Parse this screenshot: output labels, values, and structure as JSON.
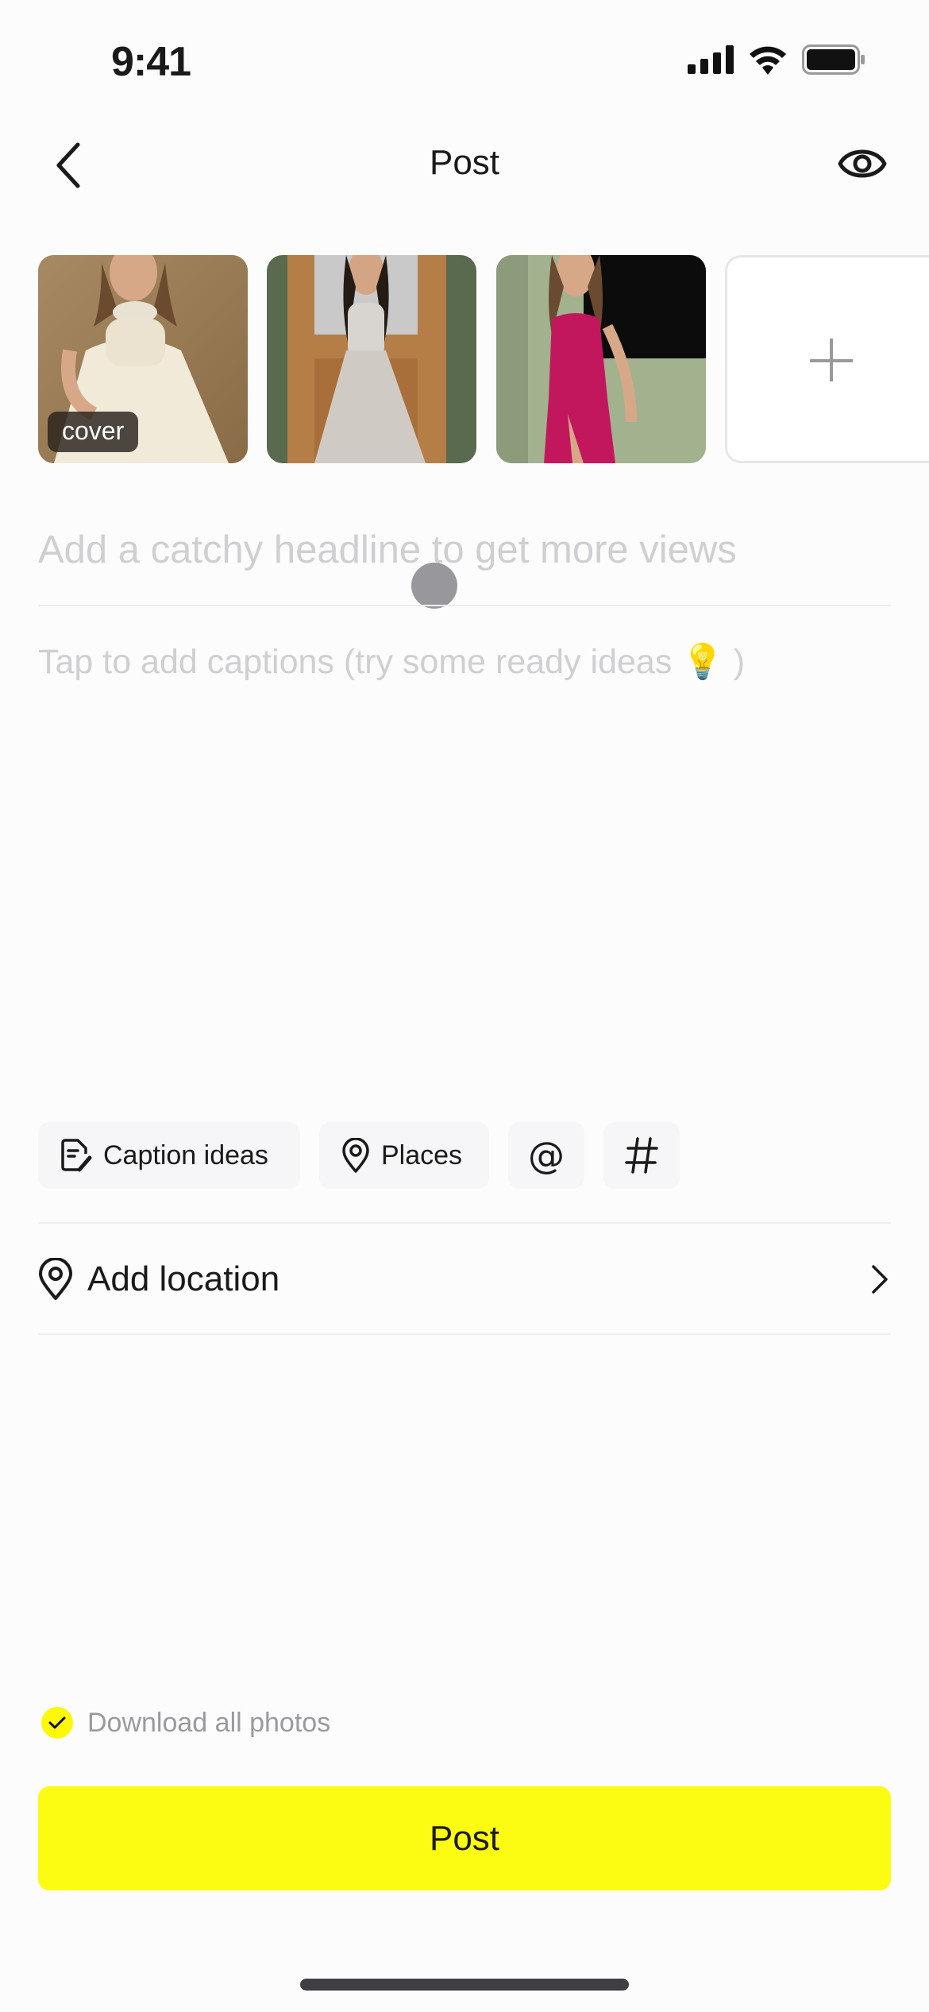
{
  "status_bar": {
    "time": "9:41"
  },
  "nav": {
    "title": "Post",
    "back_icon": "chevron-left-icon",
    "preview_icon": "eye-icon"
  },
  "photos": [
    {
      "description": "Woman in ivory satin gown with pearl necklace",
      "badge": "cover",
      "bg": "#b89a72",
      "dress": "#efe8d8"
    },
    {
      "description": "Woman in silver gown in front of wooden door",
      "badge": "",
      "bg": "#b7824c",
      "dress": "#cfccc6"
    },
    {
      "description": "Woman in magenta satin dress by green wall",
      "badge": "",
      "bg": "#8e9f7e",
      "dress": "#c1185d"
    }
  ],
  "add_photo": {
    "icon": "plus-icon"
  },
  "editor": {
    "headline_placeholder": "Add a catchy headline to get more views",
    "caption_placeholder": "Tap to add captions (try some ready ideas",
    "caption_emoji": "💡",
    "caption_suffix": ")"
  },
  "chips": [
    {
      "label": "Caption ideas",
      "icon": "caption-edit-icon"
    },
    {
      "label": "Places",
      "icon": "location-pin-icon"
    },
    {
      "label": "",
      "icon": "at-icon",
      "glyph": "@"
    },
    {
      "label": "",
      "icon": "hashtag-icon",
      "glyph": "#"
    }
  ],
  "location": {
    "label": "Add location",
    "icon": "location-pin-icon"
  },
  "download": {
    "label": "Download all photos",
    "checked": true
  },
  "post_button": {
    "label": "Post"
  },
  "colors": {
    "accent": "#fcfc12",
    "placeholder": "#cfcfd2",
    "chip_bg": "#f6f5f7"
  }
}
